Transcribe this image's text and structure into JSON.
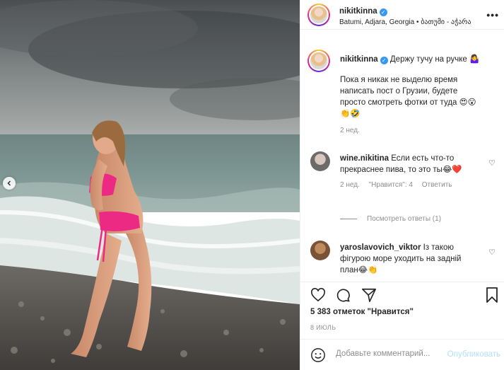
{
  "post": {
    "username": "nikitkinna",
    "location": "Batumi, Adjara, Georgia • ბათუმი - აჭარა",
    "caption_title": "Держу тучу на ручке 🤷‍♀️",
    "caption_body": "Пока я никак не выделю время написать пост о Грузии, будете просто смотреть фотки от туда 😍😮👏🤣",
    "caption_time": "2 нед.",
    "likes": "5 383 отметок \"Нравится\"",
    "date": "8 ИЮЛЬ"
  },
  "comments": [
    {
      "username": "wine.nikitina",
      "text": "Если есть что-то прекраснее пива, то это ты😂❤️",
      "time": "2 нед.",
      "likes": "\"Нравится\": 4",
      "reply": "Ответить",
      "view_replies": "Посмотреть ответы (1)"
    },
    {
      "username": "yaroslavovich_viktor",
      "text": "Із такою фігурою море уходить на задній план😂👏"
    }
  ],
  "add_comment": {
    "placeholder": "Добавьте комментарий...",
    "publish": "Опубликовать"
  },
  "icons": {
    "verified": "✓",
    "heart_small": "♡",
    "more": "•••",
    "emoji": "☺"
  }
}
